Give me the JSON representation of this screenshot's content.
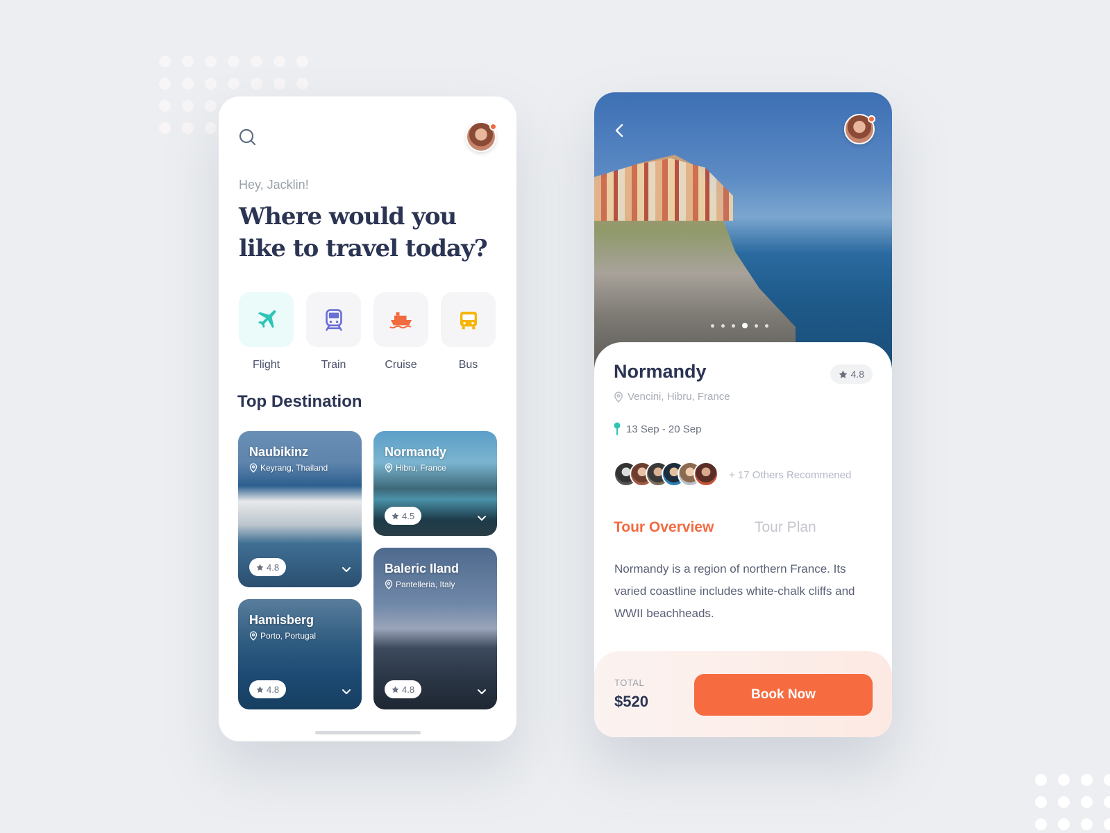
{
  "home": {
    "greeting": "Hey, Jacklin!",
    "headline": "Where would you like to travel today?",
    "transport": [
      {
        "label": "Flight",
        "icon": "plane-icon",
        "color": "#2ec4b6"
      },
      {
        "label": "Train",
        "icon": "train-icon",
        "color": "#6a6fd6"
      },
      {
        "label": "Cruise",
        "icon": "ship-icon",
        "color": "#f26a3f"
      },
      {
        "label": "Bus",
        "icon": "bus-icon",
        "color": "#f5b50a"
      }
    ],
    "section_title": "Top Destination",
    "destinations": [
      {
        "name": "Naubikinz",
        "location": "Keyrang, Thailand",
        "rating": "4.8"
      },
      {
        "name": "Normandy",
        "location": "Hibru, France",
        "rating": "4.5"
      },
      {
        "name": "Hamisberg",
        "location": "Porto, Portugal",
        "rating": "4.8"
      },
      {
        "name": "Baleric Iland",
        "location": "Pantelleria, Italy",
        "rating": "4.8"
      }
    ]
  },
  "detail": {
    "place": "Normandy",
    "rating": "4.8",
    "location": "Vencini, Hibru, France",
    "dates": "13 Sep - 20 Sep",
    "others": "+ 17 Others Recommened",
    "tabs": {
      "overview": "Tour Overview",
      "plan": "Tour Plan"
    },
    "description": "Normandy is a region of northern France. Its varied coastline includes white-chalk cliffs and WWII beachheads.",
    "total_label": "TOTAL",
    "total_value": "$520",
    "book_label": "Book Now",
    "pager": {
      "count": 6,
      "active": 3
    }
  },
  "colors": {
    "accent": "#f66b3f",
    "navy": "#2b3453",
    "teal": "#2ec4b6"
  }
}
